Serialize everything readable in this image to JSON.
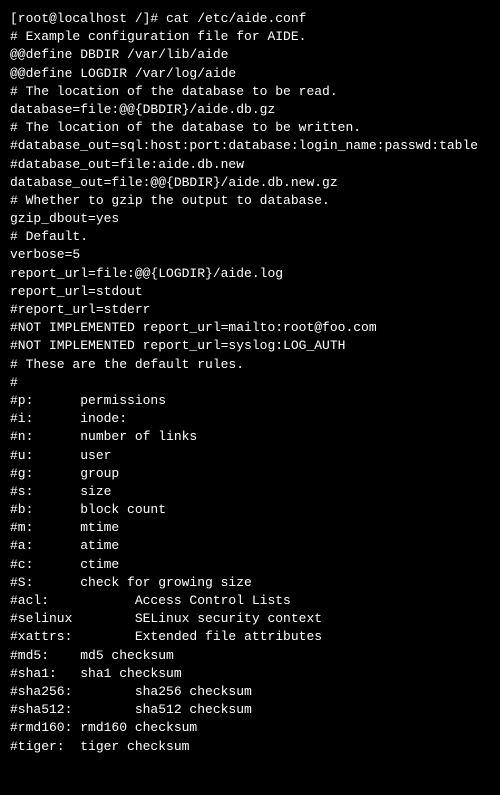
{
  "prompt": "[root@localhost /]# ",
  "command": "cat /etc/aide.conf",
  "lines": [
    "# Example configuration file for AIDE.",
    "",
    "@@define DBDIR /var/lib/aide",
    "@@define LOGDIR /var/log/aide",
    "",
    "# The location of the database to be read.",
    "database=file:@@{DBDIR}/aide.db.gz",
    "",
    "# The location of the database to be written.",
    "#database_out=sql:host:port:database:login_name:passwd:table",
    "#database_out=file:aide.db.new",
    "database_out=file:@@{DBDIR}/aide.db.new.gz",
    "",
    "# Whether to gzip the output to database.",
    "gzip_dbout=yes",
    "",
    "# Default.",
    "verbose=5",
    "",
    "report_url=file:@@{LOGDIR}/aide.log",
    "report_url=stdout",
    "#report_url=stderr",
    "#NOT IMPLEMENTED report_url=mailto:root@foo.com",
    "#NOT IMPLEMENTED report_url=syslog:LOG_AUTH",
    "",
    "# These are the default rules.",
    "#",
    "#p:      permissions",
    "#i:      inode:",
    "#n:      number of links",
    "#u:      user",
    "#g:      group",
    "#s:      size",
    "#b:      block count",
    "#m:      mtime",
    "#a:      atime",
    "#c:      ctime",
    "#S:      check for growing size",
    "#acl:           Access Control Lists",
    "#selinux        SELinux security context",
    "#xattrs:        Extended file attributes",
    "#md5:    md5 checksum",
    "#sha1:   sha1 checksum",
    "#sha256:        sha256 checksum",
    "#sha512:        sha512 checksum",
    "#rmd160: rmd160 checksum",
    "#tiger:  tiger checksum"
  ]
}
